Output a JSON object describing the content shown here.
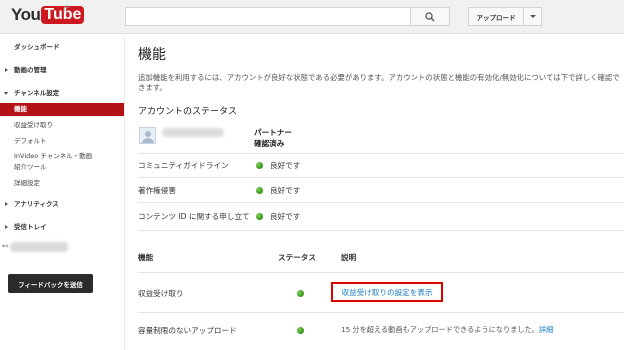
{
  "header": {
    "logo_you": "You",
    "logo_tube": "Tube",
    "logo_region": "JP",
    "search_placeholder": "",
    "upload_label": "アップロード"
  },
  "sidebar": {
    "items": [
      {
        "label": "ダッシュボード"
      },
      {
        "label": "動画の管理"
      },
      {
        "label": "チャンネル設定"
      },
      {
        "label": "機能"
      },
      {
        "label": "収益受け取り"
      },
      {
        "label": "デフォルト"
      },
      {
        "label": "InVideo チャンネル・動画"
      },
      {
        "label": "紹介ツール"
      },
      {
        "label": "詳細設定"
      },
      {
        "label": "アナリティクス"
      },
      {
        "label": "受信トレイ"
      }
    ],
    "feedback_label": "フィードバックを送信"
  },
  "main": {
    "title": "機能",
    "intro": "追加機能を利用するには、アカウントが良好な状態である必要があります。アカウントの状態と機能の有効化/無効化については下で詳しく確認できます。",
    "account_status_title": "アカウントのステータス",
    "partner_status_line1": "パートナー",
    "partner_status_line2": "確認済み",
    "status_rows": [
      {
        "label": "コミュニティガイドライン",
        "value": "良好です"
      },
      {
        "label": "著作権侵害",
        "value": "良好です"
      },
      {
        "label": "コンテンツ ID に関する申し立て",
        "value": "良好です"
      }
    ],
    "columns": {
      "feature": "機能",
      "status": "ステータス",
      "description": "説明"
    },
    "features": [
      {
        "label": "収益受け取り",
        "link": "収益受け取りの設定を表示"
      },
      {
        "label": "容量制限のないアップロード",
        "description": "15 分を超える動画もアップロードできるようになりました。",
        "link": "詳細"
      }
    ]
  },
  "colors": {
    "brand_red": "#cc181e",
    "active_nav": "#b31217",
    "link_blue": "#167ac6",
    "status_green": "#3b9a1f",
    "highlight_red": "#e00000"
  }
}
